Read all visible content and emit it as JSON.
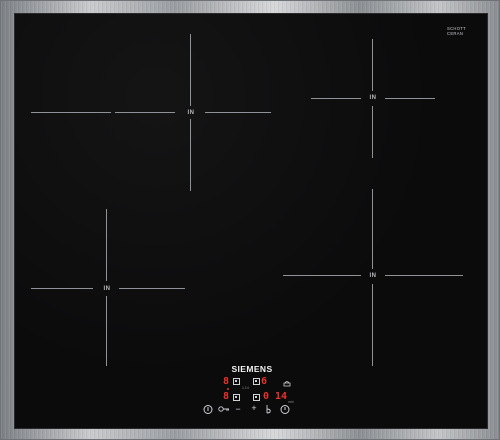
{
  "appliance": {
    "brand": "SIEMENS",
    "glass_label": "SCHOTT CERAN",
    "small_model_text": "",
    "colors": {
      "glass": "#0b0b0c",
      "frame": "#b6b8bb",
      "zone_marks": "#8f9296",
      "display_red": "#e8322c",
      "controls": "#d0d2d5"
    }
  },
  "zones": [
    {
      "id": "front-left",
      "indicator": "IN"
    },
    {
      "id": "rear-left",
      "indicator": "IN"
    },
    {
      "id": "rear-right",
      "indicator": "IN"
    },
    {
      "id": "front-right",
      "indicator": "IN"
    }
  ],
  "display": {
    "top_left_digit": "8",
    "top_right_digit": "6",
    "bottom_left_digit": "8",
    "bottom_right_digits": "0 14",
    "small_label": "1.14",
    "timer_unit": "min"
  },
  "controls": {
    "power_icon": "power-icon",
    "lock_icon": "key-lock-icon",
    "minus": "−",
    "plus": "+",
    "boost_icon": "boost-icon",
    "timer_icon": "timer-icon",
    "pan_icon": "pan-icon"
  }
}
